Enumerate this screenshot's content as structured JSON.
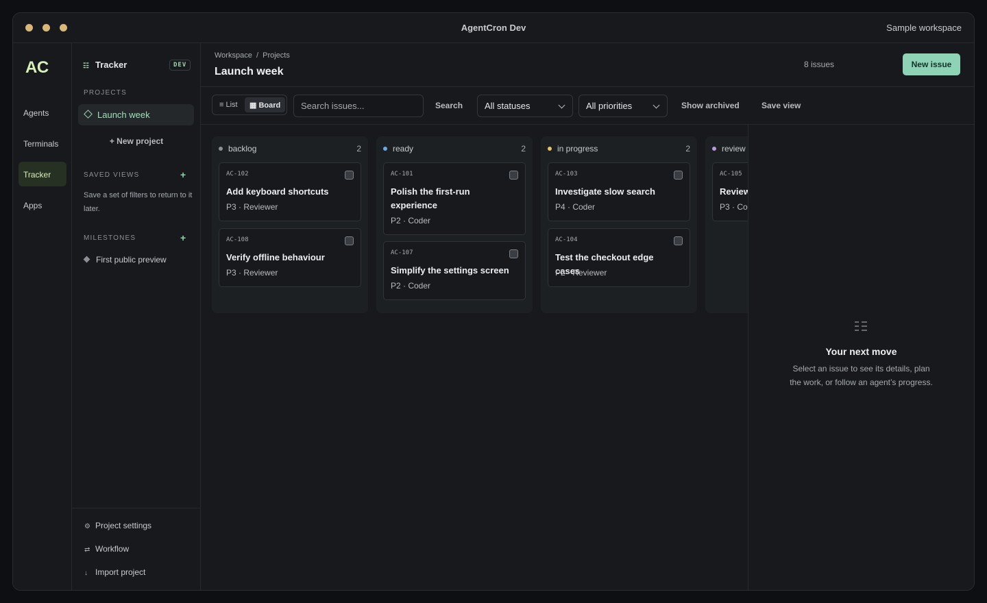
{
  "window": {
    "title": "AgentCron Dev",
    "workspace": "Sample workspace"
  },
  "rail": {
    "logo": "AC",
    "items": [
      {
        "label": "Agents"
      },
      {
        "label": "Terminals"
      },
      {
        "label": "Tracker"
      },
      {
        "label": "Apps"
      }
    ]
  },
  "sidebar": {
    "title": "Tracker",
    "badge": "DEV",
    "projects_label": "PROJECTS",
    "projects": [
      {
        "label": "Launch week"
      }
    ],
    "new_project": "+ New project",
    "saved_views_label": "SAVED VIEWS",
    "saved_views_empty": "Save a set of filters to return to it later.",
    "milestones_label": "MILESTONES",
    "milestones": [
      {
        "label": "First public preview"
      }
    ],
    "links": [
      {
        "label": "Project settings",
        "icon": "gear-icon"
      },
      {
        "label": "Workflow",
        "icon": "workflow-icon"
      },
      {
        "label": "Import project",
        "icon": "import-icon"
      }
    ]
  },
  "header": {
    "breadcrumb": [
      "Workspace",
      "Projects"
    ],
    "title": "Launch week",
    "issue_count": "8 issues",
    "new_issue": "New issue"
  },
  "toolbar": {
    "view_list": "List",
    "view_board": "Board",
    "search_placeholder": "Search issues...",
    "search_button": "Search",
    "status_filter": "All statuses",
    "priority_filter": "All priorities",
    "show_archived": "Show archived",
    "save_view": "Save view"
  },
  "columns": [
    {
      "name": "backlog",
      "count": "2",
      "color": "#8c9096",
      "cards": [
        {
          "id": "AC-102",
          "title": "Add keyboard shortcuts",
          "meta": "P3 · Reviewer"
        },
        {
          "id": "AC-108",
          "title": "Verify offline behaviour",
          "meta": "P3 · Reviewer"
        }
      ]
    },
    {
      "name": "ready",
      "count": "2",
      "color": "#6ea8e0",
      "cards": [
        {
          "id": "AC-101",
          "title": "Polish the first-run experience",
          "meta": "P2 · Coder"
        },
        {
          "id": "AC-107",
          "title": "Simplify the settings screen",
          "meta": "P2 · Coder"
        }
      ]
    },
    {
      "name": "in progress",
      "count": "2",
      "color": "#e3c46a",
      "cards": [
        {
          "id": "AC-103",
          "title": "Investigate slow search",
          "meta": "P4 · Coder"
        },
        {
          "id": "AC-104",
          "title": "Test the checkout edge cases",
          "meta": "P2 · Reviewer"
        }
      ]
    },
    {
      "name": "review",
      "count": "",
      "color": "#b89ad8",
      "cards": [
        {
          "id": "AC-105",
          "title": "Review",
          "meta": "P3 · Co"
        }
      ]
    }
  ],
  "detail": {
    "icon": "list-icon",
    "title": "Your next move",
    "text": "Select an issue to see its details, plan the work, or follow an agent’s progress."
  }
}
